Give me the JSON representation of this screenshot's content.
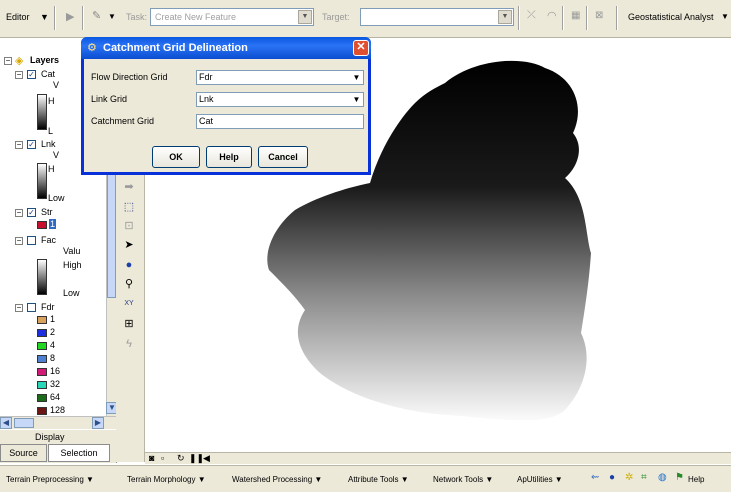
{
  "top_toolbar": {
    "editor_label": "Editor",
    "task_label": "Task:",
    "task_value": "Create New Feature",
    "target_label": "Target:",
    "target_value": "",
    "geostat_label": "Geostatistical Analyst"
  },
  "toc": {
    "root_label": "Layers",
    "layers": {
      "cat": {
        "name": "Cat",
        "val": "V",
        "high": "H",
        "low": "L"
      },
      "lnk": {
        "name": "Lnk",
        "val": "V",
        "high": "H",
        "low": "Low"
      },
      "str": {
        "name": "Str",
        "value": "1"
      },
      "fac": {
        "name": "Fac",
        "val": "Valu",
        "high": "High",
        "low": "Low"
      },
      "fdr": {
        "name": "Fdr",
        "classes": [
          {
            "label": "1",
            "color": "#d9a25c"
          },
          {
            "label": "2",
            "color": "#1c2fe0"
          },
          {
            "label": "4",
            "color": "#22d622"
          },
          {
            "label": "8",
            "color": "#4f7fd0"
          },
          {
            "label": "16",
            "color": "#d21a79"
          },
          {
            "label": "32",
            "color": "#2ad6b8"
          },
          {
            "label": "64",
            "color": "#1b6b1b"
          },
          {
            "label": "128",
            "color": "#6b1515"
          }
        ]
      }
    },
    "tabs": {
      "display": "Display",
      "source": "Source",
      "selection": "Selection"
    }
  },
  "dialog": {
    "title": "Catchment Grid Delineation",
    "flow_direction_label": "Flow Direction Grid",
    "flow_direction_value": "Fdr",
    "link_grid_label": "Link Grid",
    "link_grid_value": "Lnk",
    "catchment_grid_label": "Catchment Grid",
    "catchment_grid_value": "Cat",
    "ok_label": "OK",
    "help_label": "Help",
    "cancel_label": "Cancel"
  },
  "bottom_toolbar": {
    "items": [
      "Terrain Preprocessing",
      "Terrain Morphology",
      "Watershed Processing",
      "Attribute Tools",
      "Network Tools",
      "ApUtilities"
    ],
    "help_label": "Help"
  },
  "colors": {
    "dialog_border": "#0831d9",
    "toolbar_bg": "#ece9d8",
    "str_swatch": "#c8102e"
  }
}
